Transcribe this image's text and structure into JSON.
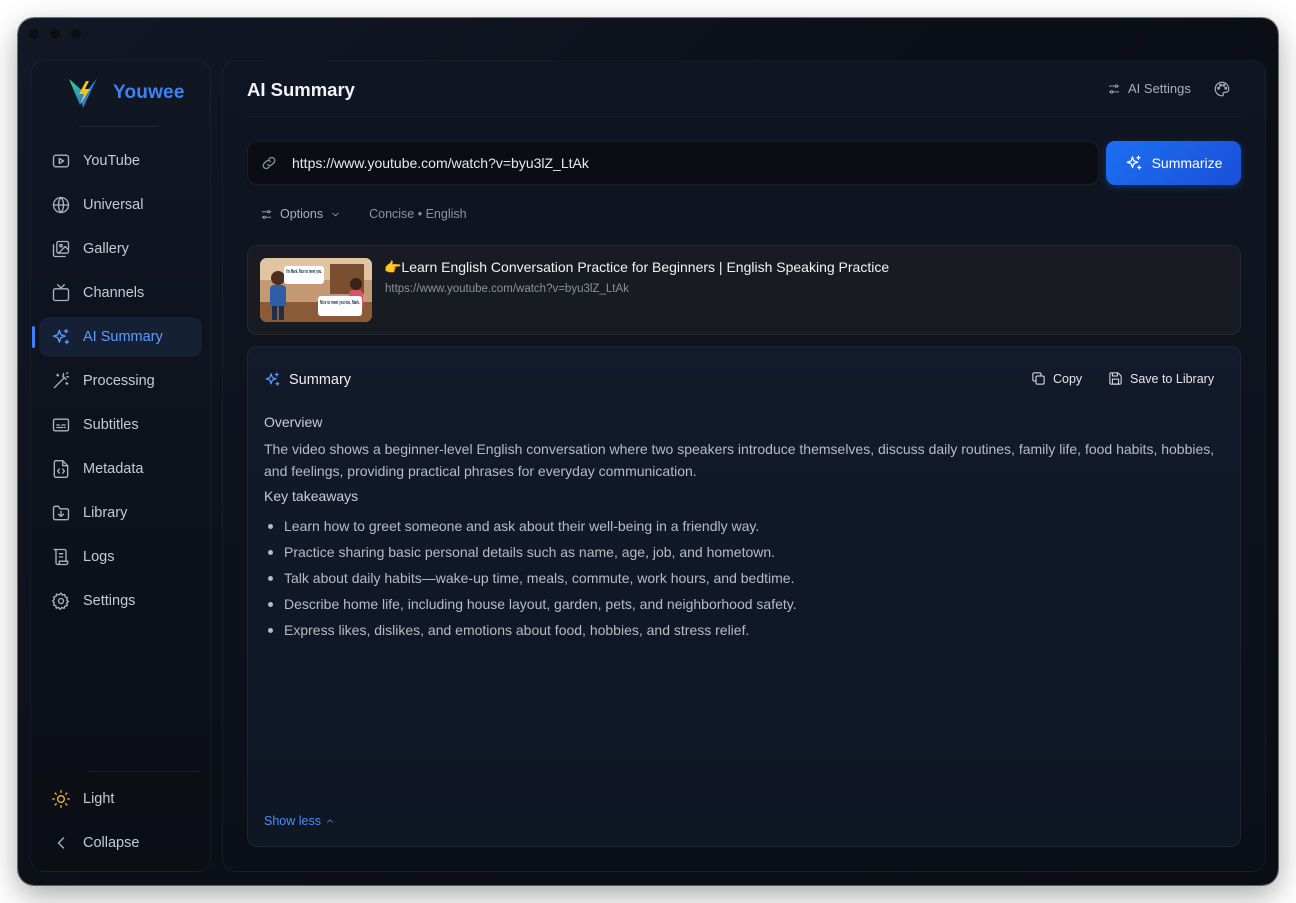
{
  "app": {
    "name": "Youwee"
  },
  "sidebar": {
    "items": [
      {
        "label": "YouTube",
        "icon": "youtube-icon"
      },
      {
        "label": "Universal",
        "icon": "globe-icon"
      },
      {
        "label": "Gallery",
        "icon": "gallery-icon"
      },
      {
        "label": "Channels",
        "icon": "tv-icon"
      },
      {
        "label": "AI Summary",
        "icon": "sparkles-icon",
        "active": true
      },
      {
        "label": "Processing",
        "icon": "magic-wand-icon"
      },
      {
        "label": "Subtitles",
        "icon": "subtitles-icon"
      },
      {
        "label": "Metadata",
        "icon": "file-code-icon"
      },
      {
        "label": "Library",
        "icon": "folder-download-icon"
      },
      {
        "label": "Logs",
        "icon": "scroll-icon"
      },
      {
        "label": "Settings",
        "icon": "gear-icon"
      }
    ],
    "bottom": {
      "theme_label": "Light",
      "collapse_label": "Collapse"
    }
  },
  "header": {
    "title": "AI Summary",
    "ai_settings_label": "AI Settings"
  },
  "input": {
    "url_value": "https://www.youtube.com/watch?v=byu3lZ_LtAk",
    "summarize_label": "Summarize"
  },
  "options": {
    "label": "Options",
    "meta": "Concise • English"
  },
  "video": {
    "title": "👉Learn English Conversation Practice for Beginners | English Speaking Practice",
    "url": "https://www.youtube.com/watch?v=byu3lZ_LtAk",
    "thumb_bubble_1": "I'm Mark. Nice to meet you.",
    "thumb_bubble_2": "Nice to meet you too, Mark."
  },
  "summary": {
    "title": "Summary",
    "copy_label": "Copy",
    "save_label": "Save to Library",
    "overview_heading": "Overview",
    "overview_text": "The video shows a beginner-level English conversation where two speakers introduce themselves, discuss daily routines, family life, food habits, hobbies, and feelings, providing practical phrases for everyday communication.",
    "takeaways_heading": "Key takeaways",
    "takeaways": [
      "Learn how to greet someone and ask about their well-being in a friendly way.",
      "Practice sharing basic personal details such as name, age, job, and hometown.",
      "Talk about daily habits—wake-up time, meals, commute, work hours, and bedtime.",
      "Describe home life, including house layout, garden, pets, and neighborhood safety.",
      "Express likes, dislikes, and emotions about food, hobbies, and stress relief."
    ],
    "show_less_label": "Show less"
  },
  "colors": {
    "accent": "#3b82f6",
    "button": "#1d6ff2",
    "background": "#0b0f18"
  }
}
